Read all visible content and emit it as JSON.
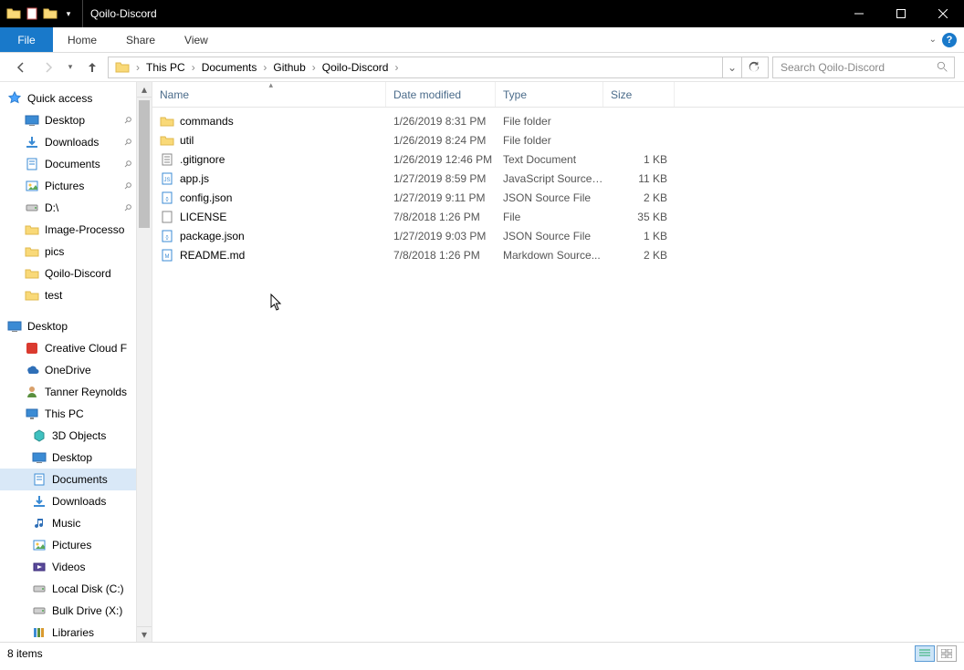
{
  "window": {
    "title": "Qoilo-Discord"
  },
  "tabs": {
    "file": "File",
    "home": "Home",
    "share": "Share",
    "view": "View"
  },
  "breadcrumb": [
    "This PC",
    "Documents",
    "Github",
    "Qoilo-Discord"
  ],
  "search": {
    "placeholder": "Search Qoilo-Discord"
  },
  "columns": {
    "name": "Name",
    "date": "Date modified",
    "type": "Type",
    "size": "Size"
  },
  "tree": {
    "quick_access": "Quick access",
    "qa_items": [
      {
        "label": "Desktop",
        "icon": "desktop",
        "pin": true
      },
      {
        "label": "Downloads",
        "icon": "downloads",
        "pin": true
      },
      {
        "label": "Documents",
        "icon": "documents",
        "pin": true
      },
      {
        "label": "Pictures",
        "icon": "pictures",
        "pin": true
      },
      {
        "label": "D:\\",
        "icon": "drive",
        "pin": true
      },
      {
        "label": "Image-Processo",
        "icon": "folder",
        "pin": false
      },
      {
        "label": "pics",
        "icon": "folder",
        "pin": false
      },
      {
        "label": "Qoilo-Discord",
        "icon": "folder",
        "pin": false
      },
      {
        "label": "test",
        "icon": "folder",
        "pin": false
      }
    ],
    "desktop": "Desktop",
    "desk_items": [
      {
        "label": "Creative Cloud F",
        "icon": "cc"
      },
      {
        "label": "OneDrive",
        "icon": "onedrive"
      },
      {
        "label": "Tanner Reynolds",
        "icon": "user"
      },
      {
        "label": "This PC",
        "icon": "thispc"
      }
    ],
    "pc_items": [
      {
        "label": "3D Objects",
        "icon": "3d"
      },
      {
        "label": "Desktop",
        "icon": "desktop"
      },
      {
        "label": "Documents",
        "icon": "documents",
        "selected": true
      },
      {
        "label": "Downloads",
        "icon": "downloads"
      },
      {
        "label": "Music",
        "icon": "music"
      },
      {
        "label": "Pictures",
        "icon": "pictures"
      },
      {
        "label": "Videos",
        "icon": "videos"
      },
      {
        "label": "Local Disk (C:)",
        "icon": "drive"
      },
      {
        "label": "Bulk Drive (X:)",
        "icon": "drive"
      },
      {
        "label": "Libraries",
        "icon": "libraries"
      }
    ]
  },
  "files": [
    {
      "name": "commands",
      "date": "1/26/2019 8:31 PM",
      "type": "File folder",
      "size": "",
      "icon": "folder"
    },
    {
      "name": "util",
      "date": "1/26/2019 8:24 PM",
      "type": "File folder",
      "size": "",
      "icon": "folder"
    },
    {
      "name": ".gitignore",
      "date": "1/26/2019 12:46 PM",
      "type": "Text Document",
      "size": "1 KB",
      "icon": "txt"
    },
    {
      "name": "app.js",
      "date": "1/27/2019 8:59 PM",
      "type": "JavaScript Source ...",
      "size": "11 KB",
      "icon": "js"
    },
    {
      "name": "config.json",
      "date": "1/27/2019 9:11 PM",
      "type": "JSON Source File",
      "size": "2 KB",
      "icon": "json"
    },
    {
      "name": "LICENSE",
      "date": "7/8/2018 1:26 PM",
      "type": "File",
      "size": "35 KB",
      "icon": "file"
    },
    {
      "name": "package.json",
      "date": "1/27/2019 9:03 PM",
      "type": "JSON Source File",
      "size": "1 KB",
      "icon": "json"
    },
    {
      "name": "README.md",
      "date": "7/8/2018 1:26 PM",
      "type": "Markdown Source...",
      "size": "2 KB",
      "icon": "md"
    }
  ],
  "status": {
    "items": "8 items"
  }
}
